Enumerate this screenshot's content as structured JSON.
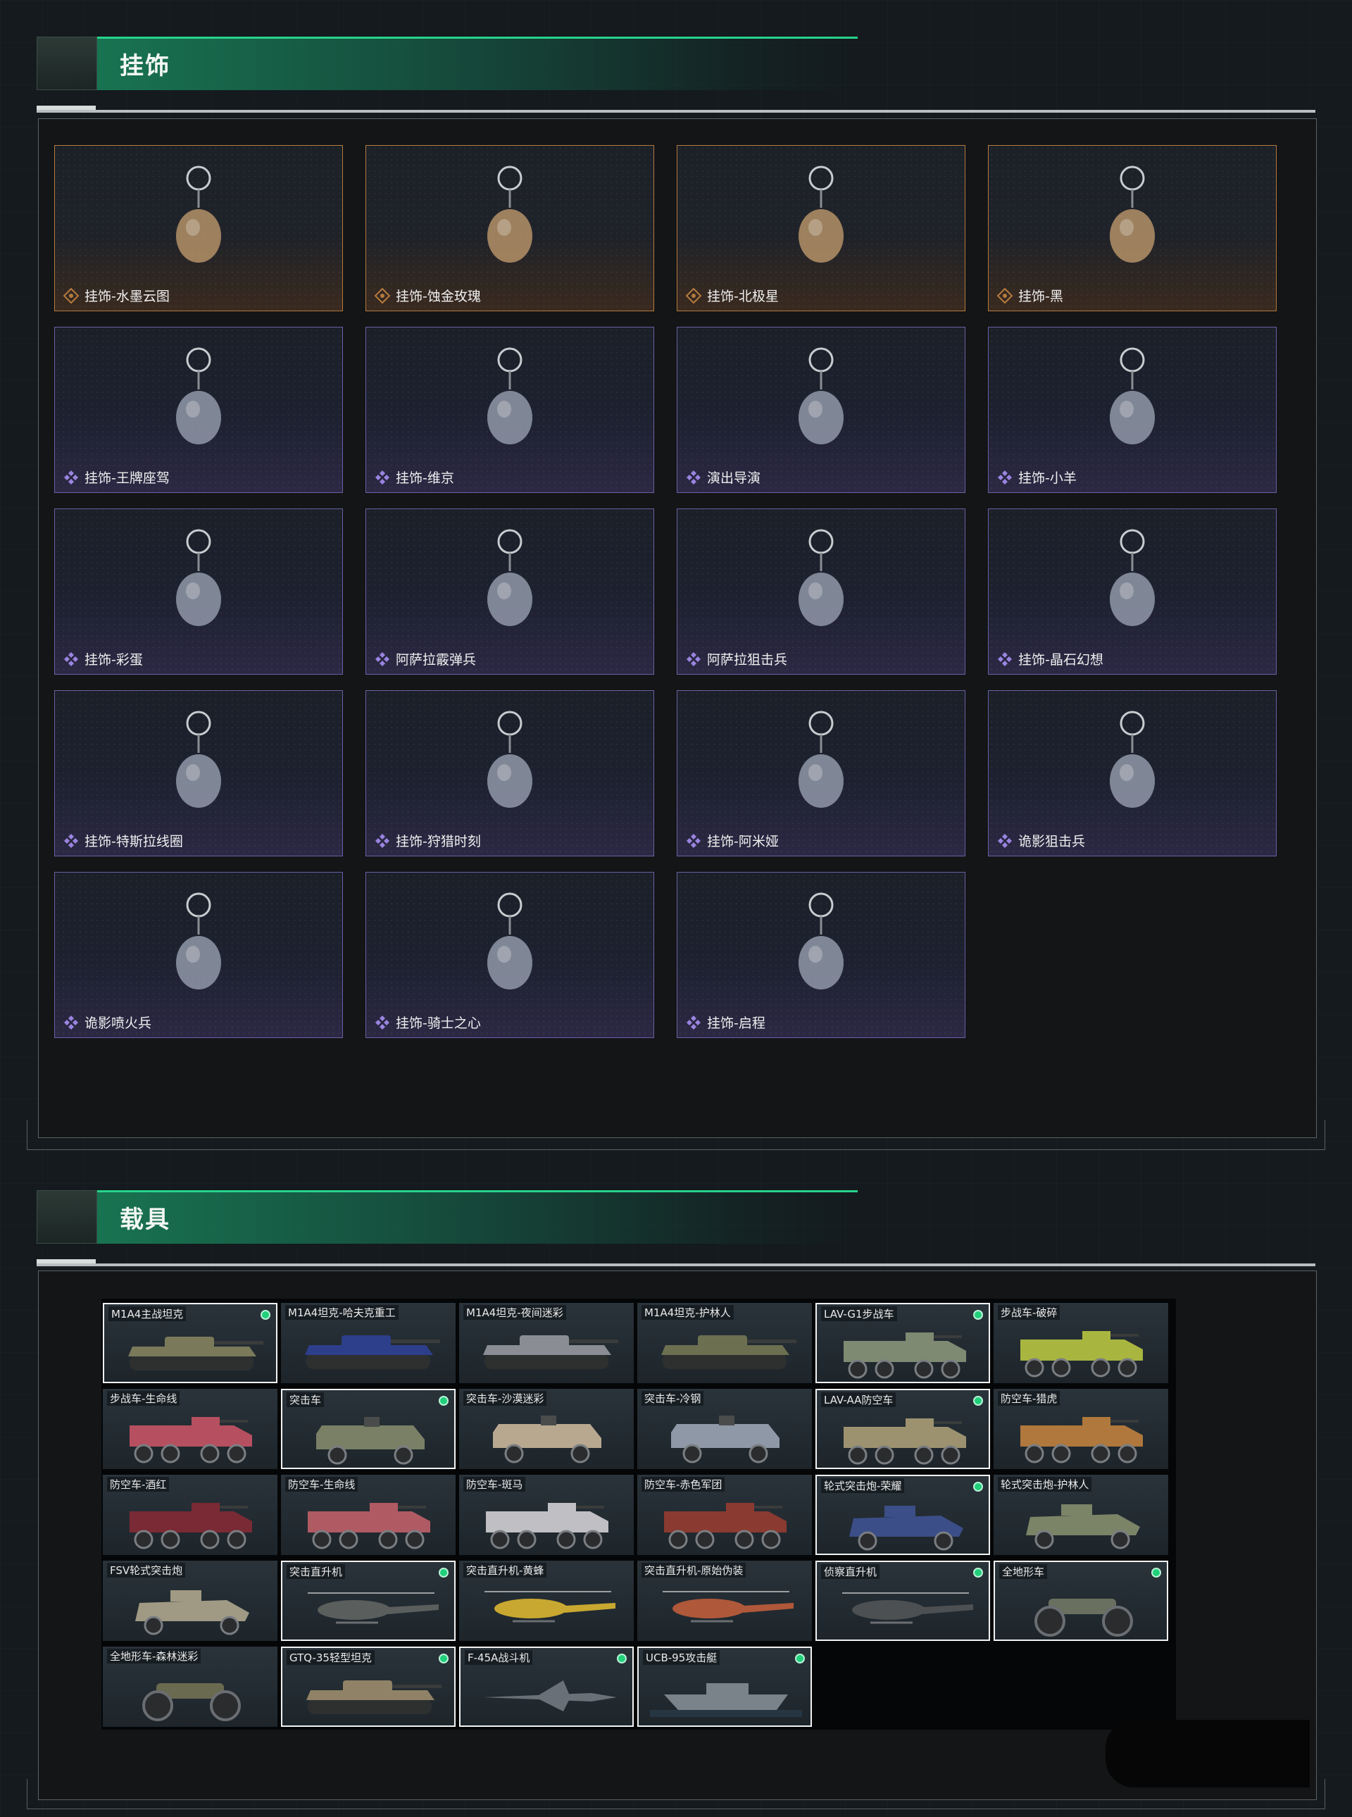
{
  "accessories_section": {
    "title": "挂饰"
  },
  "vehicles_section": {
    "title": "载具"
  },
  "colors": {
    "accent_green": "#27d38c",
    "rarity_gold": "#b67a3e",
    "rarity_purple": "#6d5fa6",
    "owned_dot": "#21d07a"
  },
  "accessories": [
    {
      "label": "挂饰-水墨云图",
      "rarity": "gold",
      "icon": "orb-charm-icon"
    },
    {
      "label": "挂饰-蚀金玫瑰",
      "rarity": "gold",
      "icon": "rose-charm-icon"
    },
    {
      "label": "挂饰-北极星",
      "rarity": "gold",
      "icon": "star-charm-icon"
    },
    {
      "label": "挂饰-黑",
      "rarity": "gold",
      "icon": "tag-charm-icon"
    },
    {
      "label": "挂饰-王牌座驾",
      "rarity": "purple",
      "icon": "jet-charm-icon"
    },
    {
      "label": "挂饰-维京",
      "rarity": "purple",
      "icon": "hammer-charm-icon"
    },
    {
      "label": "演出导演",
      "rarity": "purple",
      "icon": "figure-charm-icon"
    },
    {
      "label": "挂饰-小羊",
      "rarity": "purple",
      "icon": "sheep-charm-icon"
    },
    {
      "label": "挂饰-彩蛋",
      "rarity": "purple",
      "icon": "egg-charm-icon"
    },
    {
      "label": "阿萨拉霰弹兵",
      "rarity": "purple",
      "icon": "soldier-charm-icon"
    },
    {
      "label": "阿萨拉狙击兵",
      "rarity": "purple",
      "icon": "sniper-charm-icon"
    },
    {
      "label": "挂饰-晶石幻想",
      "rarity": "purple",
      "icon": "crystal-charm-icon"
    },
    {
      "label": "挂饰-特斯拉线圈",
      "rarity": "purple",
      "icon": "coil-charm-icon"
    },
    {
      "label": "挂饰-狩猎时刻",
      "rarity": "purple",
      "icon": "antler-charm-icon"
    },
    {
      "label": "挂饰-阿米娅",
      "rarity": "purple",
      "icon": "bunny-charm-icon"
    },
    {
      "label": "诡影狙击兵",
      "rarity": "purple",
      "icon": "ghost-sniper-charm-icon"
    },
    {
      "label": "诡影喷火兵",
      "rarity": "purple",
      "icon": "flamer-charm-icon"
    },
    {
      "label": "挂饰-骑士之心",
      "rarity": "purple",
      "icon": "shield-charm-icon"
    },
    {
      "label": "挂饰-启程",
      "rarity": "purple",
      "icon": "medal-charm-icon"
    }
  ],
  "vehicles": [
    {
      "label": "M1A4主战坦克",
      "owned": true,
      "kind": "tank",
      "color": "#7a7a5a"
    },
    {
      "label": "M1A4坦克-哈夫克重工",
      "owned": false,
      "kind": "tank",
      "color": "#2d3f8a"
    },
    {
      "label": "M1A4坦克-夜间迷彩",
      "owned": false,
      "kind": "tank",
      "color": "#8a8e94"
    },
    {
      "label": "M1A4坦克-护林人",
      "owned": false,
      "kind": "tank",
      "color": "#6c7050"
    },
    {
      "label": "LAV-G1步战车",
      "owned": true,
      "kind": "apc",
      "color": "#7e8a72"
    },
    {
      "label": "步战车-破碎",
      "owned": false,
      "kind": "apc",
      "color": "#a8b640"
    },
    {
      "label": "步战车-生命线",
      "owned": false,
      "kind": "apc",
      "color": "#b65060"
    },
    {
      "label": "突击车",
      "owned": true,
      "kind": "truck",
      "color": "#7a8066"
    },
    {
      "label": "突击车-沙漠迷彩",
      "owned": false,
      "kind": "truck",
      "color": "#b8a890"
    },
    {
      "label": "突击车-冷钢",
      "owned": false,
      "kind": "truck",
      "color": "#8e98a6"
    },
    {
      "label": "LAV-AA防空车",
      "owned": true,
      "kind": "apc",
      "color": "#9c9270"
    },
    {
      "label": "防空车-猎虎",
      "owned": false,
      "kind": "apc",
      "color": "#b0783c"
    },
    {
      "label": "防空车-酒红",
      "owned": false,
      "kind": "apc",
      "color": "#7a2a34"
    },
    {
      "label": "防空车-生命线",
      "owned": false,
      "kind": "apc",
      "color": "#b05a64"
    },
    {
      "label": "防空车-斑马",
      "owned": false,
      "kind": "apc",
      "color": "#c0c0c4"
    },
    {
      "label": "防空车-赤色军团",
      "owned": false,
      "kind": "apc",
      "color": "#8a3a30"
    },
    {
      "label": "轮式突击炮-荣耀",
      "owned": true,
      "kind": "buggy",
      "color": "#3c4e88"
    },
    {
      "label": "轮式突击炮-护林人",
      "owned": false,
      "kind": "buggy",
      "color": "#7c8468"
    },
    {
      "label": "FSV轮式突击炮",
      "owned": false,
      "kind": "buggy",
      "color": "#a09a84"
    },
    {
      "label": "突击直升机",
      "owned": true,
      "kind": "heli",
      "color": "#5a5e5c"
    },
    {
      "label": "突击直升机-黄蜂",
      "owned": false,
      "kind": "heli",
      "color": "#c8a830"
    },
    {
      "label": "突击直升机-原始伪装",
      "owned": false,
      "kind": "heli",
      "color": "#b0583a"
    },
    {
      "label": "侦察直升机",
      "owned": true,
      "kind": "heli",
      "color": "#4c5052"
    },
    {
      "label": "全地形车",
      "owned": true,
      "kind": "atv",
      "color": "#6a7060"
    },
    {
      "label": "全地形车-森林迷彩",
      "owned": false,
      "kind": "atv",
      "color": "#6a6a50"
    },
    {
      "label": "GTQ-35轻型坦克",
      "owned": true,
      "kind": "tank",
      "color": "#908266"
    },
    {
      "label": "F-45A战斗机",
      "owned": true,
      "kind": "jet",
      "color": "#6a7078"
    },
    {
      "label": "UCB-95攻击艇",
      "owned": true,
      "kind": "boat",
      "color": "#7a828a"
    }
  ]
}
